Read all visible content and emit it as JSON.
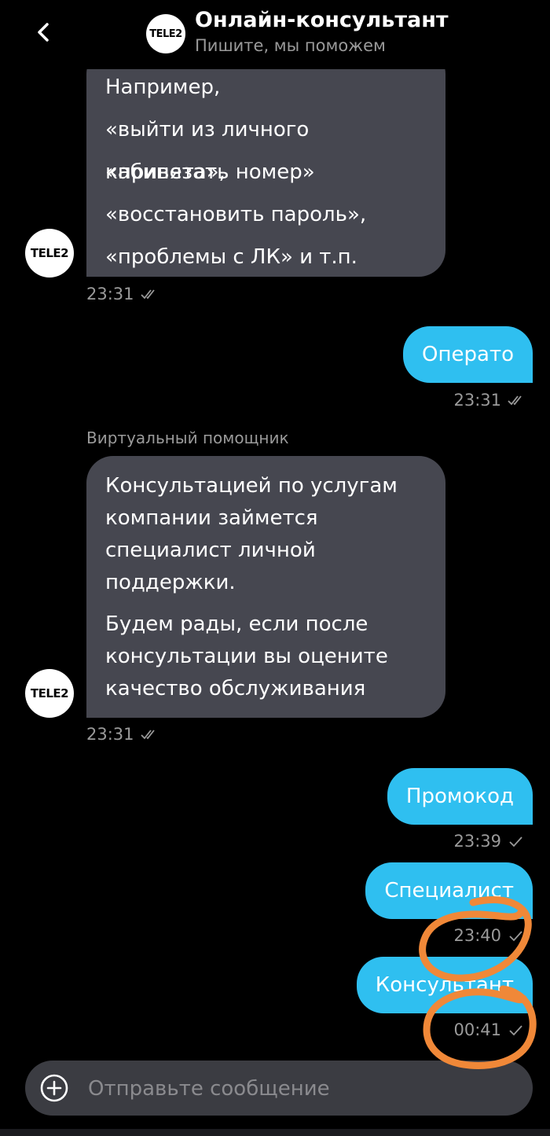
{
  "header": {
    "title": "Онлайн-консультант",
    "subtitle": "Пишите, мы поможем",
    "logo_text": "TELE2"
  },
  "messages": [
    {
      "type": "incoming",
      "lines": [
        "Например,",
        "«выйти из личного кабинета»,",
        "«привязать номер»",
        "«восстановить пароль»,",
        "«проблемы с ЛК» и т.п."
      ],
      "time": "23:31",
      "status": "read"
    },
    {
      "type": "outgoing",
      "text": "Операто",
      "time": "23:31",
      "status": "read"
    },
    {
      "type": "incoming",
      "sender": "Виртуальный помощник",
      "lines": [
        "Консультацией по услугам",
        "компании займется",
        "специалист личной",
        "поддержки.",
        "Будем рады, если после",
        "консультации вы оцените",
        "качество обслуживания"
      ],
      "time": "23:31",
      "status": "read"
    },
    {
      "type": "outgoing",
      "text": "Промокод",
      "time": "23:39",
      "status": "sent"
    },
    {
      "type": "outgoing",
      "text": "Специалист",
      "time": "23:40",
      "status": "sent"
    },
    {
      "type": "outgoing",
      "text": "Консультант",
      "time": "00:41",
      "status": "sent"
    }
  ],
  "input": {
    "placeholder": "Отправьте сообщение"
  },
  "colors": {
    "background": "#000000",
    "incoming": "#464750",
    "outgoing": "#2fbff0",
    "annotation": "#f08838"
  }
}
